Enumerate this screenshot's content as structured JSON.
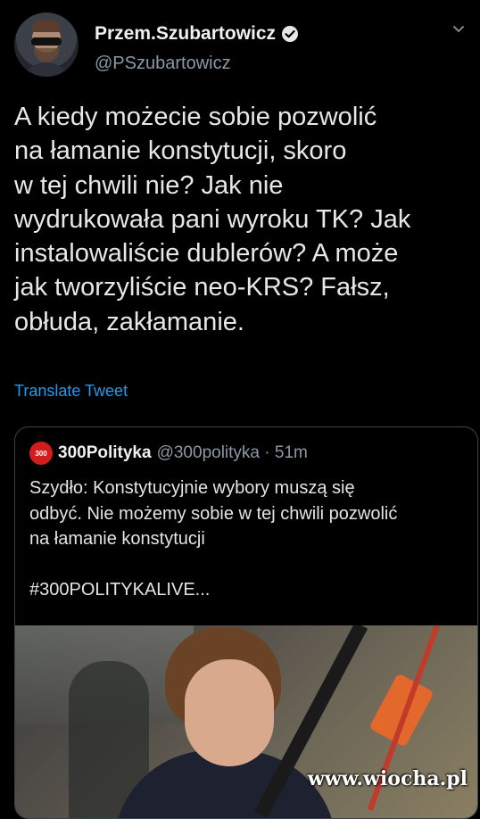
{
  "tweet": {
    "display_name": "Przem.Szubartowicz",
    "handle": "@PSzubartowicz",
    "text": "A kiedy możecie sobie pozwolić\nna łamanie konstytucji, skoro\nw tej chwili nie? Jak nie\nwydrukowała pani wyroku TK? Jak\ninstalowaliście dublerów? A może\njak tworzyliście neo-KRS? Fałsz,\nobłuda, zakłamanie.",
    "translate_label": "Translate Tweet"
  },
  "quoted": {
    "logo_text": "300",
    "display_name": "300Polityka",
    "handle_time": "@300polityka · 51m",
    "text": "Szydło: Konstytucyjnie wybory muszą się\nodbyć. Nie możemy sobie w tej chwili pozwolić\nna łamanie konstytucji\n\n#300POLITYKALIVE..."
  },
  "watermark": "www.wiocha.pl",
  "colors": {
    "link": "#1d9bf0",
    "muted": "#8b98a5",
    "background": "#000000"
  }
}
